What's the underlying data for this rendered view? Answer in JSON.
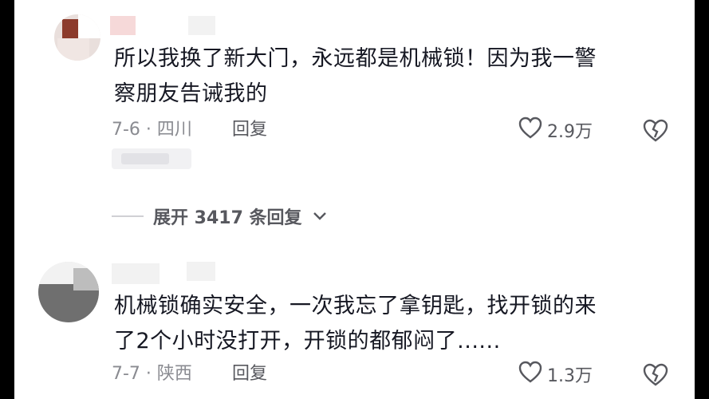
{
  "comments": [
    {
      "text_line1": "所以我换了新大门，永远都是机械锁！因为我一警",
      "text_line2": "察朋友告诫我的",
      "meta": "7-6 · 四川",
      "reply_label": "回复",
      "likes": "2.9万"
    },
    {
      "text_line1": "机械锁确实安全，一次我忘了拿钥匙，找开锁的来",
      "text_line2": "了2个小时没打开，开锁的都郁闷了......",
      "meta": "7-7 · 陕西",
      "reply_label": "回复",
      "likes": "1.3万"
    }
  ],
  "expand_label": "展开 3417 条回复",
  "icons": {
    "like": "heart-outline-icon",
    "dislike": "broken-heart-icon",
    "expand": "chevron-down-icon"
  }
}
